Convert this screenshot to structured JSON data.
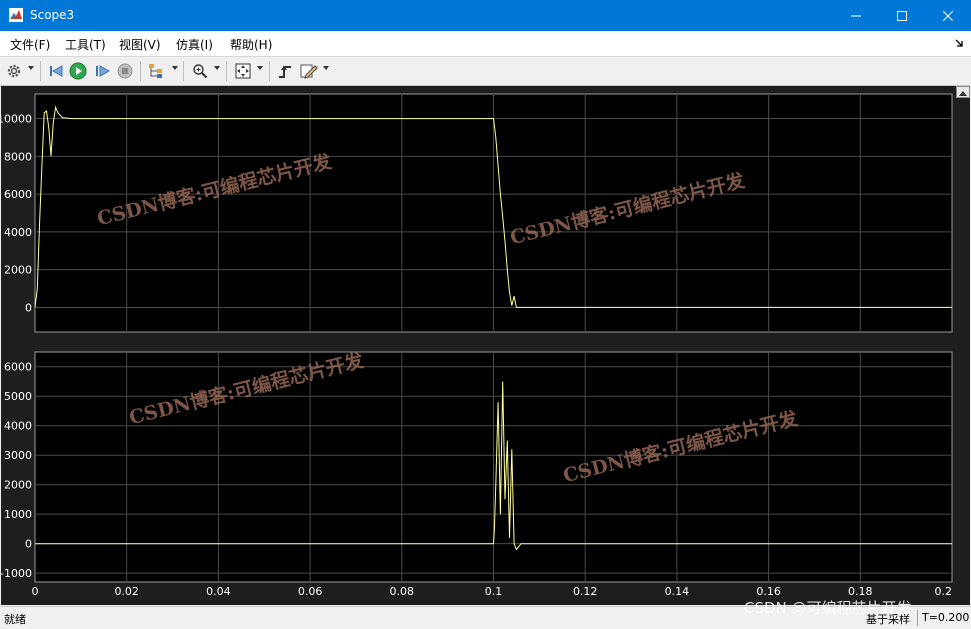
{
  "window": {
    "title": "Scope3"
  },
  "menu": {
    "items": [
      "文件(F)",
      "工具(T)",
      "视图(V)",
      "仿真(I)",
      "帮助(H)"
    ]
  },
  "plot1": {
    "yticks": [
      "10000",
      "8000",
      "6000",
      "4000",
      "2000",
      "0"
    ]
  },
  "plot2": {
    "yticks": [
      "6000",
      "5000",
      "4000",
      "3000",
      "2000",
      "1000",
      "0",
      "-1000"
    ]
  },
  "xaxis": {
    "ticks": [
      "0",
      "0.02",
      "0.04",
      "0.06",
      "0.08",
      "0.1",
      "0.12",
      "0.14",
      "0.16",
      "0.18",
      "0.2"
    ]
  },
  "watermark": {
    "text": "CSDN博客:可编程芯片开发"
  },
  "status": {
    "left": "就绪",
    "mode": "基于采样",
    "time": "T=0.200"
  },
  "csdn_mark": "CSDN @可编程芯片开发",
  "colors": {
    "titlebar": "#0078d7",
    "plot_bg": "#000000",
    "trace": "#ffff99",
    "grid": "#4a4a4a"
  },
  "chart_data": [
    {
      "type": "line",
      "x": [
        0,
        0.0005,
        0.001,
        0.0015,
        0.002,
        0.0025,
        0.003,
        0.0035,
        0.004,
        0.0045,
        0.005,
        0.006,
        0.008,
        0.02,
        0.04,
        0.06,
        0.08,
        0.1,
        0.1005,
        0.101,
        0.1015,
        0.102,
        0.1025,
        0.103,
        0.1035,
        0.104,
        0.1045,
        0.105,
        0.1055,
        0.106,
        0.12,
        0.14,
        0.16,
        0.18,
        0.2
      ],
      "y": [
        0,
        1000,
        4500,
        7500,
        10300,
        10400,
        9500,
        8000,
        9800,
        10600,
        10300,
        10050,
        10000,
        10000,
        10000,
        10000,
        10000,
        10000,
        9000,
        7500,
        6000,
        4800,
        3500,
        2000,
        800,
        100,
        600,
        0,
        0,
        0,
        0,
        0,
        0,
        0,
        0
      ],
      "xlim": [
        0,
        0.2
      ],
      "ylim": [
        -1300,
        11300
      ],
      "grid": true
    },
    {
      "type": "line",
      "x": [
        0,
        0.1,
        0.1002,
        0.1005,
        0.101,
        0.1015,
        0.102,
        0.1025,
        0.103,
        0.1035,
        0.104,
        0.1045,
        0.105,
        0.1055,
        0.106,
        0.12,
        0.14,
        0.16,
        0.18,
        0.2
      ],
      "y": [
        0,
        0,
        500,
        2000,
        4800,
        1000,
        5500,
        1500,
        3500,
        200,
        3200,
        0,
        -200,
        -100,
        0,
        0,
        0,
        0,
        0,
        0
      ],
      "xlim": [
        0,
        0.2
      ],
      "ylim": [
        -1300,
        6500
      ],
      "grid": true
    }
  ]
}
